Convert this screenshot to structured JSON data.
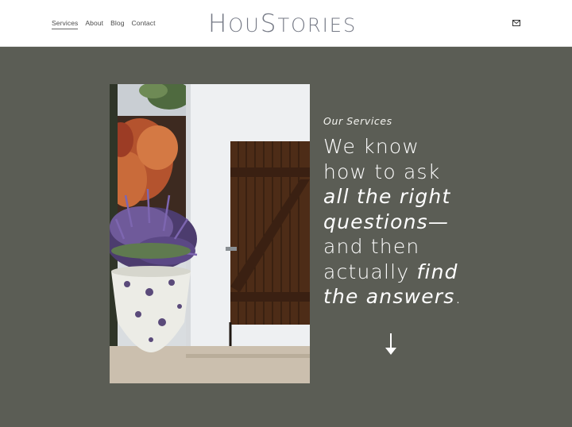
{
  "nav": {
    "items": [
      {
        "label": "Services",
        "active": true
      },
      {
        "label": "About"
      },
      {
        "label": "Blog"
      },
      {
        "label": "Contact"
      }
    ]
  },
  "brand": {
    "logo_part1_cap": "H",
    "logo_part1_rest": "OU",
    "logo_part2_cap": "S",
    "logo_part2_rest": "TORIES"
  },
  "hero": {
    "eyebrow": "Our Services",
    "headline": {
      "line1": "We know",
      "line2": "how to ask",
      "line3": "all the right",
      "line4": "questions—",
      "line5": "and then",
      "line6_plain": "actually ",
      "line6_italic": "find",
      "line7_italic": "the answers",
      "line7_end": "."
    }
  },
  "icons": {
    "mail": "mail-icon",
    "arrow": "arrow-down-icon"
  },
  "colors": {
    "background": "#5b5d55",
    "header": "#ffffff",
    "logo": "#767a86",
    "text": "#ffffff"
  }
}
